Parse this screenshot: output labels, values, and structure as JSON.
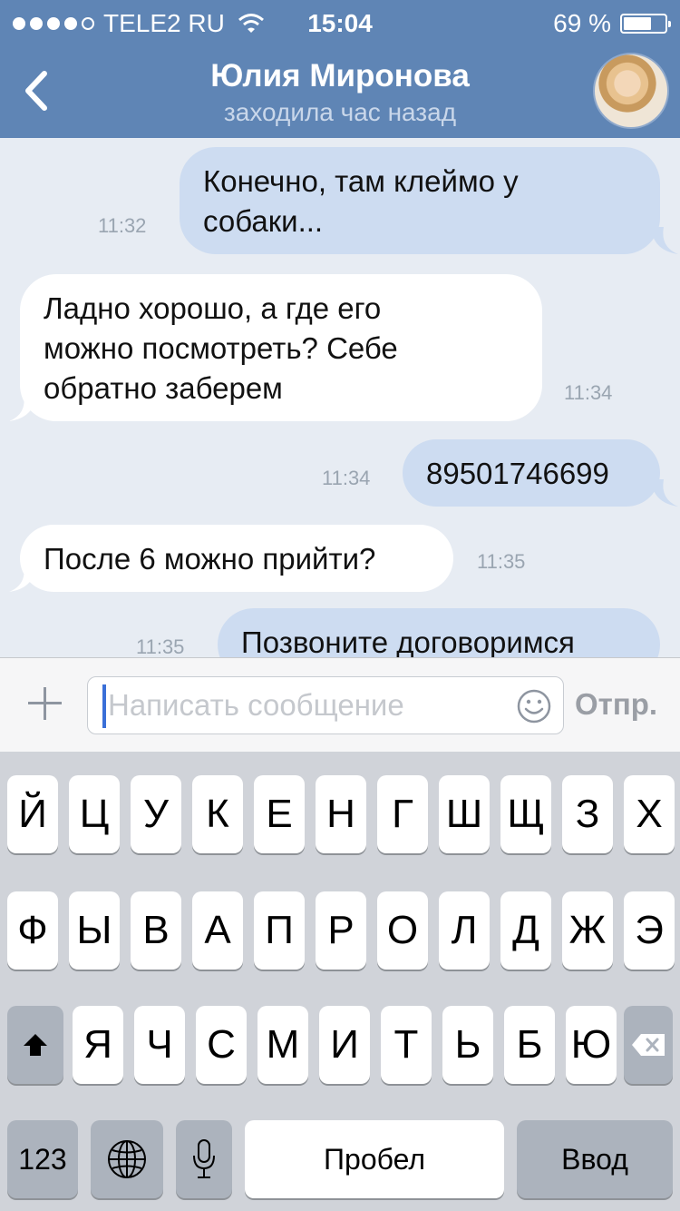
{
  "status_bar": {
    "carrier": "TELE2 RU",
    "time": "15:04",
    "battery_percent": "69 %",
    "battery_level": 0.69,
    "signal_dots": 5,
    "signal_filled": 4
  },
  "header": {
    "title": "Юлия Миронова",
    "subtitle": "заходила час назад"
  },
  "messages": [
    {
      "dir": "out",
      "lines": [
        "Конечно, там клеймо у",
        "собаки..."
      ],
      "time": "11:32"
    },
    {
      "dir": "in",
      "lines": [
        "Ладно хорошо, а где его",
        "можно посмотреть? Себе",
        "обратно заберем"
      ],
      "time": "11:34"
    },
    {
      "dir": "out",
      "lines": [
        "89501746699"
      ],
      "time": "11:34"
    },
    {
      "dir": "in",
      "lines": [
        "После 6 можно прийти?"
      ],
      "time": "11:35"
    },
    {
      "dir": "out",
      "lines": [
        "Позвоните договоримся"
      ],
      "time": "11:35"
    }
  ],
  "input": {
    "placeholder": "Написать сообщение",
    "send_label": "Отпр."
  },
  "keyboard": {
    "row1": [
      "Й",
      "Ц",
      "У",
      "К",
      "Е",
      "Н",
      "Г",
      "Ш",
      "Щ",
      "З",
      "Х"
    ],
    "row2": [
      "Ф",
      "Ы",
      "В",
      "А",
      "П",
      "Р",
      "О",
      "Л",
      "Д",
      "Ж",
      "Э"
    ],
    "row3": [
      "Я",
      "Ч",
      "С",
      "М",
      "И",
      "Т",
      "Ь",
      "Б",
      "Ю"
    ],
    "numbers_label": "123",
    "space_label": "Пробел",
    "return_label": "Ввод"
  },
  "colors": {
    "header": "#5f85b5",
    "bubble_out": "#cddcf1",
    "bubble_in": "#ffffff",
    "chat_bg": "#e7ecf3"
  }
}
